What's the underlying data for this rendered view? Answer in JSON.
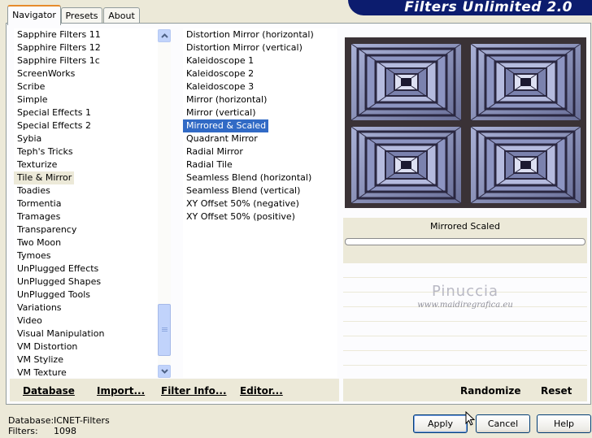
{
  "banner": {
    "title": "Filters Unlimited 2.0"
  },
  "tabs": [
    {
      "label": "Navigator",
      "active": true
    },
    {
      "label": "Presets",
      "active": false
    },
    {
      "label": "About",
      "active": false
    }
  ],
  "categories": [
    "Sapphire Filters 11",
    "Sapphire Filters 12",
    "Sapphire Filters 1c",
    "ScreenWorks",
    "Scribe",
    "Simple",
    "Special Effects 1",
    "Special Effects 2",
    "Sybia",
    "Teph's Tricks",
    "Texturize",
    "Tile & Mirror",
    "Toadies",
    "Tormentia",
    "Tramages",
    "Transparency",
    "Two Moon",
    "Tymoes",
    "UnPlugged Effects",
    "UnPlugged Shapes",
    "UnPlugged Tools",
    "Variations",
    "Video",
    "Visual Manipulation",
    "VM Distortion",
    "VM Stylize",
    "VM Texture"
  ],
  "selected_category": "Tile & Mirror",
  "filters": [
    "Distortion Mirror (horizontal)",
    "Distortion Mirror (vertical)",
    "Kaleidoscope 1",
    "Kaleidoscope 2",
    "Kaleidoscope 3",
    "Mirror (horizontal)",
    "Mirror (vertical)",
    "Mirrored & Scaled",
    "Quadrant Mirror",
    "Radial Mirror",
    "Radial Tile",
    "Seamless Blend (horizontal)",
    "Seamless Blend (vertical)",
    "XY Offset 50% (negative)",
    "XY Offset 50% (positive)"
  ],
  "selected_filter": "Mirrored & Scaled",
  "left_links": {
    "database": "Database",
    "import": "Import...",
    "filter_info": "Filter Info...",
    "editor": "Editor..."
  },
  "right_links": {
    "randomize": "Randomize",
    "reset": "Reset"
  },
  "preview": {
    "filter_name": "Mirrored  Scaled"
  },
  "watermark": {
    "name": "Pinuccia",
    "url": "www.maidiregrafica.eu"
  },
  "status": {
    "database_label": "Database:",
    "database_value": "ICNET-Filters",
    "filters_label": "Filters:",
    "filters_value": "1098"
  },
  "buttons": {
    "apply": "Apply",
    "cancel": "Cancel",
    "help": "Help"
  },
  "colors": {
    "banner": "#0c1c6e",
    "selection": "#316ac5",
    "window": "#ece9d8"
  }
}
